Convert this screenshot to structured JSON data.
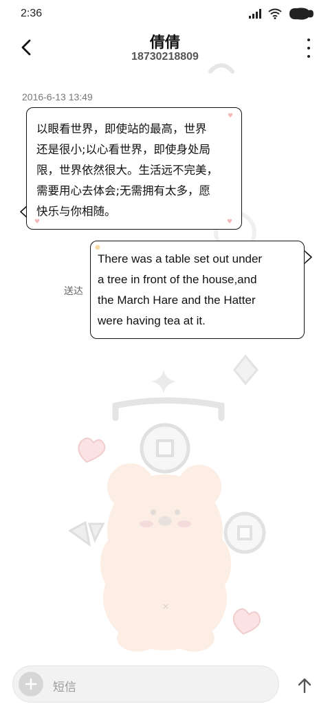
{
  "status_bar": {
    "time": "2:36",
    "icons": [
      "signal-icon",
      "wifi-icon",
      "battery-icon"
    ]
  },
  "header": {
    "contact_name": "倩倩",
    "contact_number": "18730218809",
    "icons": [
      "back-arrow-icon",
      "more-vertical-icon"
    ]
  },
  "conversation": {
    "timestamp": "2016-6-13 13:49",
    "incoming": {
      "lines": [
        "以眼看世界，即使站的最高，世界",
        "还是很小;以心看世界，即使身处局",
        "限，世界依然很大。生活远不完美，",
        "需要用心去体会;无需拥有太多，愿",
        "快乐与你相随。"
      ]
    },
    "outgoing": {
      "lines": [
        "There was a table set out under",
        "a tree in front of the house,and",
        "the March Hare and the Hatter",
        "were having tea at it."
      ],
      "status": "送达"
    }
  },
  "composer": {
    "placeholder": "短信",
    "icons": [
      "plus-icon",
      "send-arrow-icon"
    ]
  },
  "colors": {
    "bubble_border": "#111111",
    "bear_body": "#fde9de",
    "heart_pink": "#f4b9b9",
    "input_bg": "#f2f2f2"
  }
}
